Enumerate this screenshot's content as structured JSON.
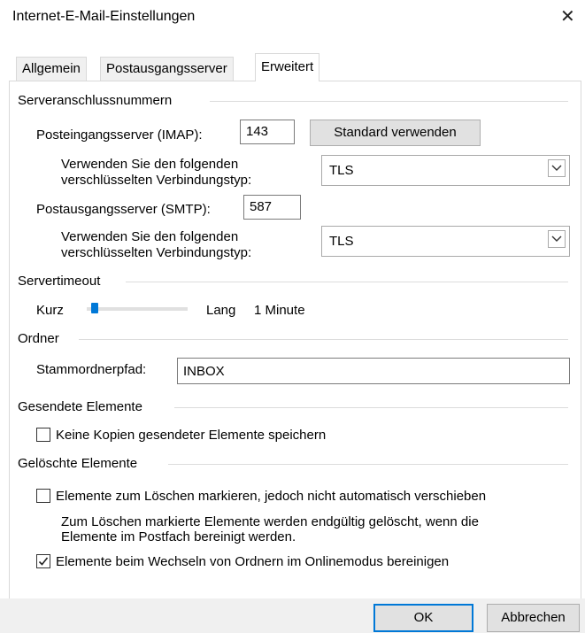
{
  "window": {
    "title": "Internet-E-Mail-Einstellungen",
    "close_glyph": "✕"
  },
  "tabs": [
    {
      "label": "Allgemein",
      "active": false
    },
    {
      "label": "Postausgangsserver",
      "active": false
    },
    {
      "label": "Erweitert",
      "active": true
    }
  ],
  "server_ports": {
    "group_label": "Serveranschlussnummern",
    "imap_label": "Posteingangsserver (IMAP):",
    "imap_value": "143",
    "default_button": "Standard verwenden",
    "imap_enc_label_1": "Verwenden Sie den folgenden",
    "imap_enc_label_2": "verschlüsselten Verbindungstyp:",
    "imap_enc_value": "TLS",
    "smtp_label": "Postausgangsserver (SMTP):",
    "smtp_value": "587",
    "smtp_enc_label_1": "Verwenden Sie den folgenden",
    "smtp_enc_label_2": "verschlüsselten Verbindungstyp:",
    "smtp_enc_value": "TLS"
  },
  "timeout": {
    "group_label": "Servertimeout",
    "short_label": "Kurz",
    "long_label": "Lang",
    "value_label": "1 Minute",
    "slider_fraction": 0.05
  },
  "folders": {
    "group_label": "Ordner",
    "root_label": "Stammordnerpfad:",
    "root_value": "INBOX"
  },
  "sent": {
    "group_label": "Gesendete Elemente",
    "no_copies_label": "Keine Kopien gesendeter Elemente speichern",
    "no_copies_checked": false
  },
  "deleted": {
    "group_label": "Gelöschte Elemente",
    "mark_label": "Elemente zum Löschen markieren, jedoch nicht automatisch verschieben",
    "mark_checked": false,
    "info_line_1": "Zum Löschen markierte Elemente werden endgültig gelöscht, wenn die",
    "info_line_2": "Elemente im Postfach bereinigt werden.",
    "purge_label": "Elemente beim Wechseln von Ordnern im Onlinemodus bereinigen",
    "purge_checked": true
  },
  "footer": {
    "ok": "OK",
    "cancel": "Abbrechen"
  },
  "colors": {
    "accent": "#0078d7",
    "button_bg": "#e1e1e1",
    "footer_bg": "#f0f0f0"
  }
}
